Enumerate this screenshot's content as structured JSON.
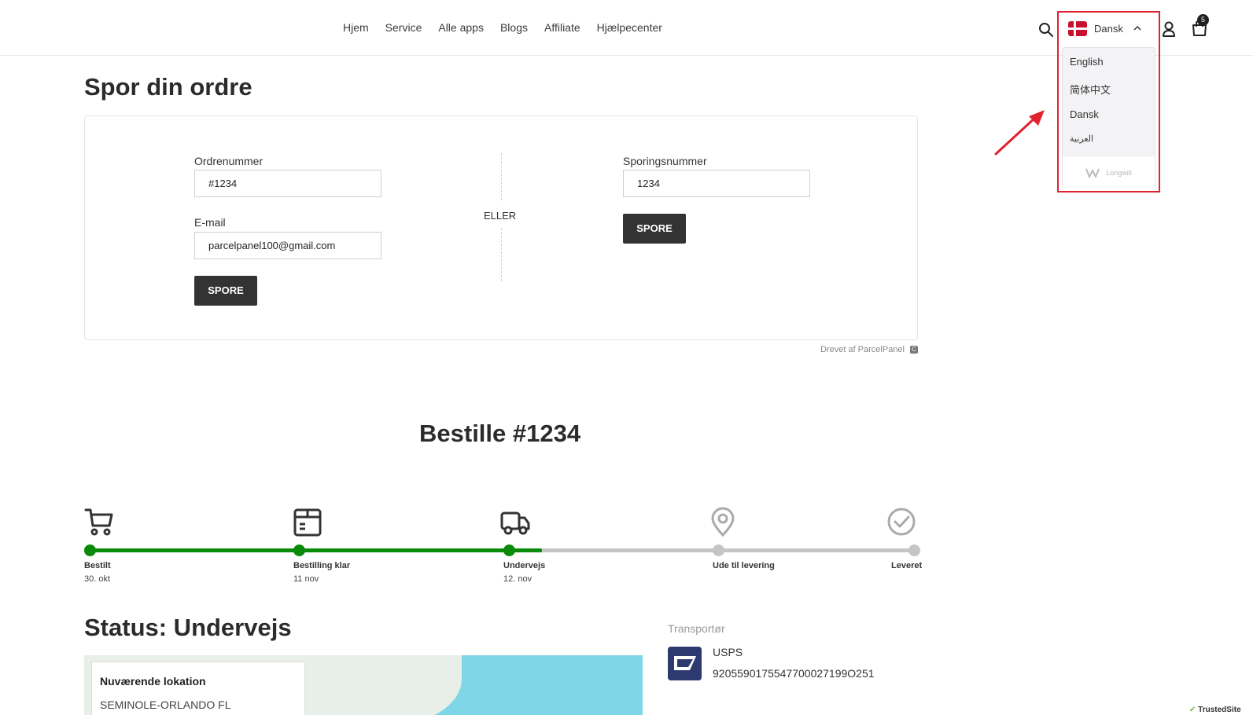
{
  "nav": {
    "items": [
      "Hjem",
      "Service",
      "Alle apps",
      "Blogs",
      "Affiliate",
      "Hjælpecenter"
    ]
  },
  "header": {
    "language_current": "Dansk",
    "cart_count": "5"
  },
  "language_dropdown": {
    "options": [
      "English",
      "简体中文",
      "Dansk",
      "العربية"
    ],
    "brand": "Longwill"
  },
  "page_title": "Spor din ordre",
  "form": {
    "order_label": "Ordrenummer",
    "order_value": "#1234",
    "email_label": "E-mail",
    "email_value": "parcelpanel100@gmail.com",
    "or_label": "ELLER",
    "tracking_label": "Sporingsnummer",
    "tracking_value": "1234",
    "submit_label": "SPORE",
    "powered_by": "Drevet af ParcelPanel"
  },
  "order_title": "Bestille #1234",
  "progress": {
    "completion": 0.55,
    "steps": [
      {
        "label": "Bestilt",
        "date": "30. okt",
        "icon": "cart-icon",
        "done": true
      },
      {
        "label": "Bestilling klar",
        "date": "11 nov",
        "icon": "package-icon",
        "done": true
      },
      {
        "label": "Undervejs",
        "date": "12. nov",
        "icon": "truck-icon",
        "done": true
      },
      {
        "label": "Ude til levering",
        "date": "",
        "icon": "location-pin-icon",
        "done": false
      },
      {
        "label": "Leveret",
        "date": "",
        "icon": "check-circle-icon",
        "done": false
      }
    ]
  },
  "status": {
    "title": "Status: Undervejs",
    "current_location_label": "Nuværende lokation",
    "current_location_value": "SEMINOLE-ORLANDO FL"
  },
  "carrier": {
    "label": "Transportør",
    "name": "USPS",
    "tracking_number": "9205590175547700027199O251"
  },
  "trusted_badge": "TrustedSite",
  "colors": {
    "progress_done": "#0a8a0a",
    "progress_todo": "#c5c5c5",
    "highlight": "#e0232e",
    "button": "#333333"
  }
}
